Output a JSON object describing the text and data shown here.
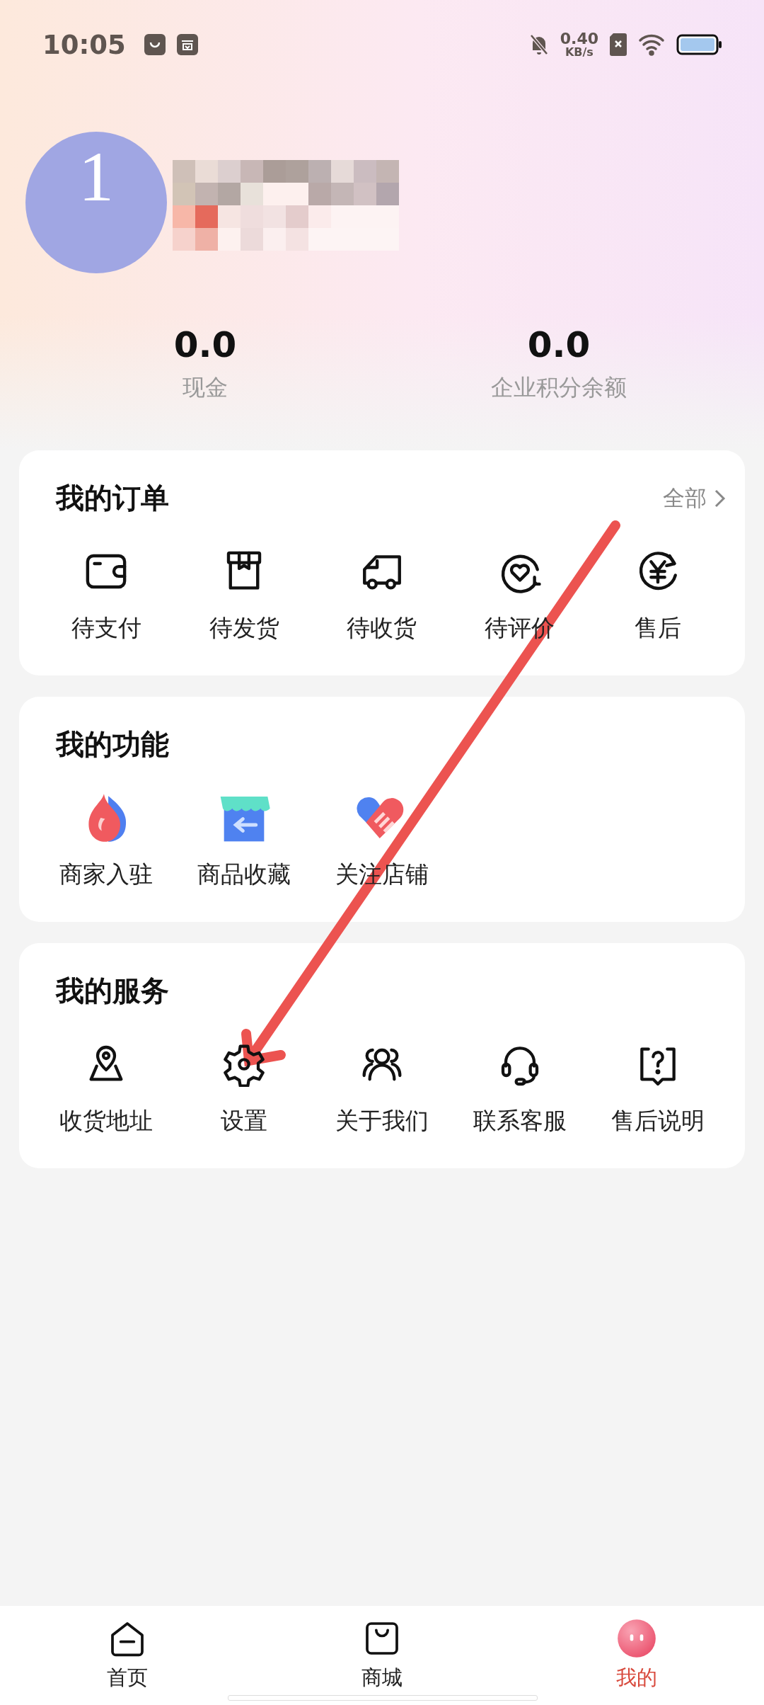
{
  "status_bar": {
    "time": "10:05",
    "speed_value": "0.40",
    "speed_unit": "KB/s"
  },
  "profile": {
    "avatar_letter": "1"
  },
  "balances": [
    {
      "value": "0.0",
      "label": "现金"
    },
    {
      "value": "0.0",
      "label": "企业积分余额"
    }
  ],
  "orders": {
    "title": "我的订单",
    "more": "全部",
    "items": [
      {
        "label": "待支付",
        "kind": "wallet"
      },
      {
        "label": "待发货",
        "kind": "box"
      },
      {
        "label": "待收货",
        "kind": "truck"
      },
      {
        "label": "待评价",
        "kind": "review"
      },
      {
        "label": "售后",
        "kind": "refund"
      }
    ]
  },
  "functions": {
    "title": "我的功能",
    "items": [
      {
        "label": "商家入驻",
        "kind": "flame"
      },
      {
        "label": "商品收藏",
        "kind": "store"
      },
      {
        "label": "关注店铺",
        "kind": "heart"
      }
    ]
  },
  "services": {
    "title": "我的服务",
    "items": [
      {
        "label": "收货地址",
        "kind": "location"
      },
      {
        "label": "设置",
        "kind": "settings"
      },
      {
        "label": "关于我们",
        "kind": "people"
      },
      {
        "label": "联系客服",
        "kind": "headset"
      },
      {
        "label": "售后说明",
        "kind": "help"
      }
    ]
  },
  "tab_bar": [
    {
      "label": "首页",
      "kind": "home",
      "selected": false
    },
    {
      "label": "商城",
      "kind": "bag",
      "selected": false
    },
    {
      "label": "我的",
      "kind": "me",
      "selected": true
    }
  ]
}
